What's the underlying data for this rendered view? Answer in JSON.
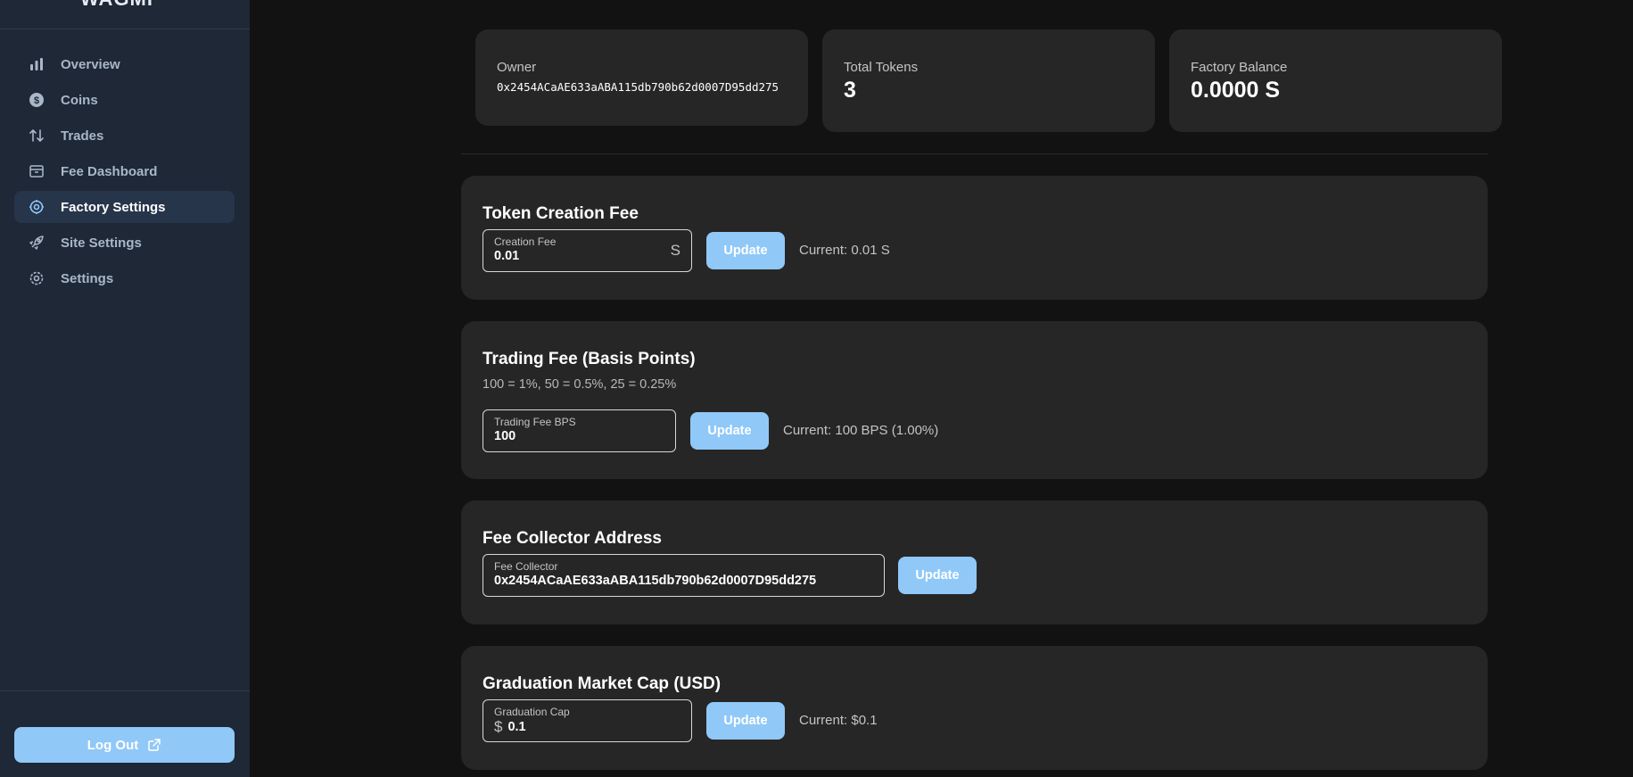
{
  "sidebar": {
    "brand": "WAGMI",
    "items": [
      {
        "label": "Overview",
        "icon": "bar-chart-icon"
      },
      {
        "label": "Coins",
        "icon": "dollar-coin-icon"
      },
      {
        "label": "Trades",
        "icon": "arrows-up-down-icon"
      },
      {
        "label": "Fee Dashboard",
        "icon": "archive-box-icon"
      },
      {
        "label": "Factory Settings",
        "icon": "cog-icon",
        "active": true
      },
      {
        "label": "Site Settings",
        "icon": "rocket-icon"
      },
      {
        "label": "Settings",
        "icon": "gear-icon"
      }
    ],
    "logout_label": "Log Out"
  },
  "stats": {
    "owner_label": "Owner",
    "owner_value": "0x2454ACaAE633aABA115db790b62d0007D95dd275",
    "tokens_label": "Total Tokens",
    "tokens_value": "3",
    "balance_label": "Factory Balance",
    "balance_value": "0.0000 S"
  },
  "creation_fee": {
    "title": "Token Creation Fee",
    "field_label": "Creation Fee",
    "field_value": "0.01",
    "suffix": "S",
    "button": "Update",
    "current": "Current: 0.01 S"
  },
  "trading_fee": {
    "title": "Trading Fee (Basis Points)",
    "description": "100 = 1%, 50 = 0.5%, 25 = 0.25%",
    "field_label": "Trading Fee BPS",
    "field_value": "100",
    "button": "Update",
    "current": "Current: 100 BPS (1.00%)"
  },
  "fee_collector": {
    "title": "Fee Collector Address",
    "field_label": "Fee Collector",
    "field_value": "0x2454ACaAE633aABA115db790b62d0007D95dd275",
    "button": "Update"
  },
  "graduation_cap": {
    "title": "Graduation Market Cap (USD)",
    "field_label": "Graduation Cap",
    "prefix": "$",
    "field_value": "0.1",
    "button": "Update",
    "current": "Current: $0.1"
  },
  "colors": {
    "accent": "#90c8f8",
    "sidebar_bg": "#1e2836",
    "page_bg": "#121212",
    "card_bg": "#262626"
  }
}
